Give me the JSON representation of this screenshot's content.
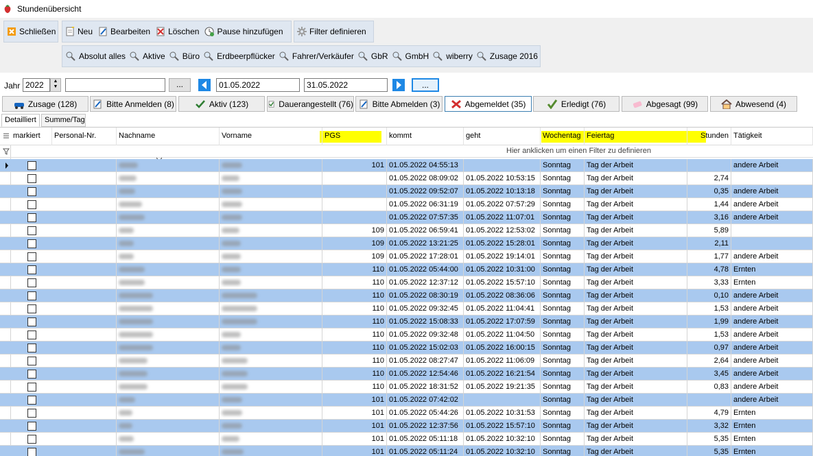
{
  "window": {
    "title": "Stundenübersicht"
  },
  "toolbar": {
    "close_label": "Schließen",
    "new_label": "Neu",
    "edit_label": "Bearbeiten",
    "delete_label": "Löschen",
    "pause_label": "Pause hinzufügen",
    "filter_define_label": "Filter definieren"
  },
  "filters": [
    "Absolut alles",
    "Aktive",
    "Büro",
    "Erdbeerpflücker",
    "Fahrer/Verkäufer",
    "GbR",
    "GmbH",
    "wiberry",
    "Zusage 2016"
  ],
  "datebar": {
    "year_label": "Jahr",
    "year_value": "2022",
    "combo_value": "",
    "dots_label": "...",
    "date_from": "01.05.2022",
    "date_to": "31.05.2022",
    "dots2_label": "..."
  },
  "status_tabs": [
    {
      "label": "Zusage (128)",
      "icon": "car-icon"
    },
    {
      "label": "Bitte Anmelden (8)",
      "icon": "edit-doc-icon"
    },
    {
      "label": "Aktiv (123)",
      "icon": "check-icon"
    },
    {
      "label": "Dauerangestellt (76)",
      "icon": "check-doc-icon"
    },
    {
      "label": "Bitte Abmelden (3)",
      "icon": "edit-doc-icon"
    },
    {
      "label": "Abgemeldet (35)",
      "icon": "cross-icon"
    },
    {
      "label": "Erledigt (76)",
      "icon": "check-green-icon"
    },
    {
      "label": "Abgesagt (99)",
      "icon": "eraser-icon"
    },
    {
      "label": "Abwesend (4)",
      "icon": "house-icon"
    }
  ],
  "view_tabs": [
    "Detailliert",
    "Summe/Tag"
  ],
  "columns": [
    "markiert",
    "Personal-Nr.",
    "Nachname",
    "Vorname",
    "PGS",
    "kommt",
    "geht",
    "Wochentag",
    "Feiertag",
    "Stunden",
    "Tätigkeit"
  ],
  "filter_hint": "Hier anklicken um einen Filter zu definieren",
  "rows": [
    {
      "pgs": "101",
      "kommt": "01.05.2022 04:55:13",
      "geht": "",
      "wochentag": "Sonntag",
      "feiertag": "Tag der Arbeit",
      "stunden": "",
      "taetigkeit": "andere Arbeit"
    },
    {
      "pgs": "",
      "kommt": "01.05.2022 08:09:02",
      "geht": "01.05.2022 10:53:15",
      "wochentag": "Sonntag",
      "feiertag": "Tag der Arbeit",
      "stunden": "2,74",
      "taetigkeit": ""
    },
    {
      "pgs": "",
      "kommt": "01.05.2022 09:52:07",
      "geht": "01.05.2022 10:13:18",
      "wochentag": "Sonntag",
      "feiertag": "Tag der Arbeit",
      "stunden": "0,35",
      "taetigkeit": "andere Arbeit"
    },
    {
      "pgs": "",
      "kommt": "01.05.2022 06:31:19",
      "geht": "01.05.2022 07:57:29",
      "wochentag": "Sonntag",
      "feiertag": "Tag der Arbeit",
      "stunden": "1,44",
      "taetigkeit": "andere Arbeit"
    },
    {
      "pgs": "",
      "kommt": "01.05.2022 07:57:35",
      "geht": "01.05.2022 11:07:01",
      "wochentag": "Sonntag",
      "feiertag": "Tag der Arbeit",
      "stunden": "3,16",
      "taetigkeit": "andere Arbeit"
    },
    {
      "pgs": "109",
      "kommt": "01.05.2022 06:59:41",
      "geht": "01.05.2022 12:53:02",
      "wochentag": "Sonntag",
      "feiertag": "Tag der Arbeit",
      "stunden": "5,89",
      "taetigkeit": ""
    },
    {
      "pgs": "109",
      "kommt": "01.05.2022 13:21:25",
      "geht": "01.05.2022 15:28:01",
      "wochentag": "Sonntag",
      "feiertag": "Tag der Arbeit",
      "stunden": "2,11",
      "taetigkeit": ""
    },
    {
      "pgs": "109",
      "kommt": "01.05.2022 17:28:01",
      "geht": "01.05.2022 19:14:01",
      "wochentag": "Sonntag",
      "feiertag": "Tag der Arbeit",
      "stunden": "1,77",
      "taetigkeit": "andere Arbeit"
    },
    {
      "pgs": "110",
      "kommt": "01.05.2022 05:44:00",
      "geht": "01.05.2022 10:31:00",
      "wochentag": "Sonntag",
      "feiertag": "Tag der Arbeit",
      "stunden": "4,78",
      "taetigkeit": "Ernten"
    },
    {
      "pgs": "110",
      "kommt": "01.05.2022 12:37:12",
      "geht": "01.05.2022 15:57:10",
      "wochentag": "Sonntag",
      "feiertag": "Tag der Arbeit",
      "stunden": "3,33",
      "taetigkeit": "Ernten"
    },
    {
      "pgs": "110",
      "kommt": "01.05.2022 08:30:19",
      "geht": "01.05.2022 08:36:06",
      "wochentag": "Sonntag",
      "feiertag": "Tag der Arbeit",
      "stunden": "0,10",
      "taetigkeit": "andere Arbeit"
    },
    {
      "pgs": "110",
      "kommt": "01.05.2022 09:32:45",
      "geht": "01.05.2022 11:04:41",
      "wochentag": "Sonntag",
      "feiertag": "Tag der Arbeit",
      "stunden": "1,53",
      "taetigkeit": "andere Arbeit"
    },
    {
      "pgs": "110",
      "kommt": "01.05.2022 15:08:33",
      "geht": "01.05.2022 17:07:59",
      "wochentag": "Sonntag",
      "feiertag": "Tag der Arbeit",
      "stunden": "1,99",
      "taetigkeit": "andere Arbeit"
    },
    {
      "pgs": "110",
      "kommt": "01.05.2022 09:32:48",
      "geht": "01.05.2022 11:04:50",
      "wochentag": "Sonntag",
      "feiertag": "Tag der Arbeit",
      "stunden": "1,53",
      "taetigkeit": "andere Arbeit"
    },
    {
      "pgs": "110",
      "kommt": "01.05.2022 15:02:03",
      "geht": "01.05.2022 16:00:15",
      "wochentag": "Sonntag",
      "feiertag": "Tag der Arbeit",
      "stunden": "0,97",
      "taetigkeit": "andere Arbeit"
    },
    {
      "pgs": "110",
      "kommt": "01.05.2022 08:27:47",
      "geht": "01.05.2022 11:06:09",
      "wochentag": "Sonntag",
      "feiertag": "Tag der Arbeit",
      "stunden": "2,64",
      "taetigkeit": "andere Arbeit"
    },
    {
      "pgs": "110",
      "kommt": "01.05.2022 12:54:46",
      "geht": "01.05.2022 16:21:54",
      "wochentag": "Sonntag",
      "feiertag": "Tag der Arbeit",
      "stunden": "3,45",
      "taetigkeit": "andere Arbeit"
    },
    {
      "pgs": "110",
      "kommt": "01.05.2022 18:31:52",
      "geht": "01.05.2022 19:21:35",
      "wochentag": "Sonntag",
      "feiertag": "Tag der Arbeit",
      "stunden": "0,83",
      "taetigkeit": "andere Arbeit"
    },
    {
      "pgs": "101",
      "kommt": "01.05.2022 07:42:02",
      "geht": "",
      "wochentag": "Sonntag",
      "feiertag": "Tag der Arbeit",
      "stunden": "",
      "taetigkeit": "andere Arbeit"
    },
    {
      "pgs": "101",
      "kommt": "01.05.2022 05:44:26",
      "geht": "01.05.2022 10:31:53",
      "wochentag": "Sonntag",
      "feiertag": "Tag der Arbeit",
      "stunden": "4,79",
      "taetigkeit": "Ernten"
    },
    {
      "pgs": "101",
      "kommt": "01.05.2022 12:37:56",
      "geht": "01.05.2022 15:57:10",
      "wochentag": "Sonntag",
      "feiertag": "Tag der Arbeit",
      "stunden": "3,32",
      "taetigkeit": "Ernten"
    },
    {
      "pgs": "101",
      "kommt": "01.05.2022 05:11:18",
      "geht": "01.05.2022 10:32:10",
      "wochentag": "Sonntag",
      "feiertag": "Tag der Arbeit",
      "stunden": "5,35",
      "taetigkeit": "Ernten"
    },
    {
      "pgs": "101",
      "kommt": "01.05.2022 05:11:24",
      "geht": "01.05.2022 10:32:10",
      "wochentag": "Sonntag",
      "feiertag": "Tag der Arbeit",
      "stunden": "5,35",
      "taetigkeit": "Ernten"
    }
  ],
  "colors": {
    "highlight": "#ffff00",
    "alt_row": "#a9c9ef",
    "accent": "#1e88e5"
  }
}
